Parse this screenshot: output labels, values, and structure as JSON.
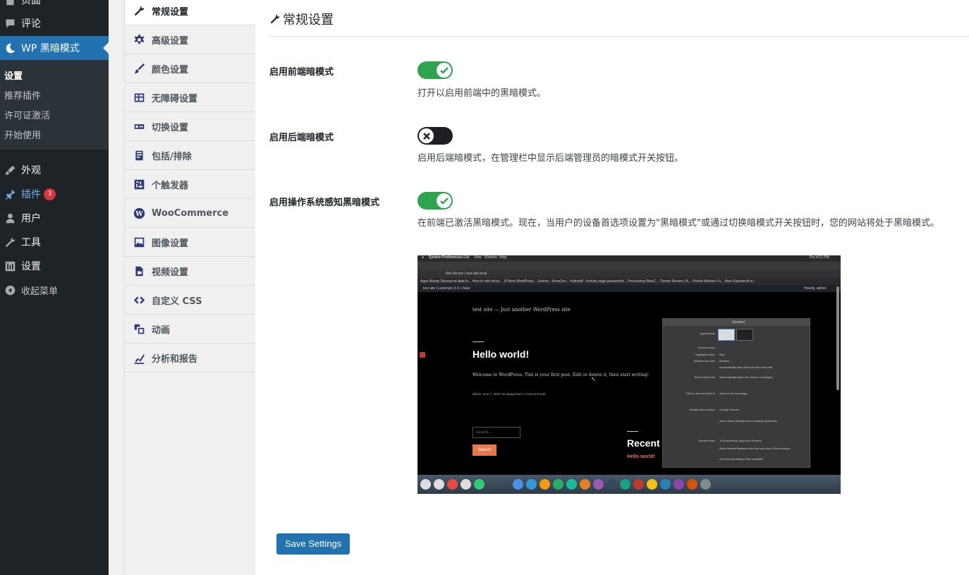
{
  "admin_menu": {
    "items": [
      {
        "label": "页面",
        "icon": "pages-icon"
      },
      {
        "label": "评论",
        "icon": "comments-icon"
      },
      {
        "label": "WP 黑暗模式",
        "icon": "moon-icon",
        "current": true
      },
      {
        "label": "外观",
        "icon": "appearance-brush-icon"
      },
      {
        "label": "插件",
        "icon": "plugins-icon",
        "badge": "3"
      },
      {
        "label": "用户",
        "icon": "users-icon"
      },
      {
        "label": "工具",
        "icon": "tools-wrench-icon"
      },
      {
        "label": "设置",
        "icon": "settings-sliders-icon"
      },
      {
        "label": "收起菜单",
        "icon": "collapse-arrow-icon"
      }
    ],
    "submenu": [
      {
        "label": "设置",
        "active": true
      },
      {
        "label": "推荐插件"
      },
      {
        "label": "许可证激活"
      },
      {
        "label": "开始使用"
      }
    ]
  },
  "settings_nav": {
    "items": [
      {
        "label": "常规设置",
        "icon": "wrench-icon",
        "active": true
      },
      {
        "label": "高级设置",
        "icon": "gear-icon"
      },
      {
        "label": "颜色设置",
        "icon": "paintbrush-icon"
      },
      {
        "label": "无障碍设置",
        "icon": "table-icon"
      },
      {
        "label": "切换设置",
        "icon": "toggle-switch-icon"
      },
      {
        "label": "包括/排除",
        "icon": "clipboard-icon"
      },
      {
        "label": "个触发器",
        "icon": "trigger-icon"
      },
      {
        "label": "WooCommerce",
        "icon": "wordpress-icon"
      },
      {
        "label": "图像设置",
        "icon": "image-icon"
      },
      {
        "label": "视频设置",
        "icon": "video-file-icon"
      },
      {
        "label": "自定义 CSS",
        "icon": "code-icon"
      },
      {
        "label": "动画",
        "icon": "animation-icon"
      },
      {
        "label": "分析和报告",
        "icon": "chart-icon"
      }
    ]
  },
  "main": {
    "title": "常规设置",
    "rows": [
      {
        "label": "启用前端暗模式",
        "enabled": true,
        "description": "打开以启用前端中的黑暗模式。"
      },
      {
        "label": "启用后端暗模式",
        "enabled": false,
        "description": "启用后端暗模式，在管理栏中显示后端管理员的暗模式开关按钮。"
      },
      {
        "label": "启用操作系统感知黑暗模式",
        "enabled": true,
        "description": "在前端已激活黑暗模式。现在，当用户的设备首选项设置为\"黑暗模式\"或通过切换暗模式开关按钮时，您的网站将处于黑暗模式。"
      }
    ],
    "save_label": "Save Settings"
  },
  "preview": {
    "menubar_app": "System Preferences",
    "menubar_items": [
      "Edit",
      "View",
      "Window",
      "Help"
    ],
    "menubar_clock": "Thu 4:21 PM",
    "address": "Not Secure | test-site.local",
    "bookmarks": "Apps   Wamp   Structured data fo...   How to edit struct...   15 Best WordPress...   Entries ‹ KeenDev...   Hubstaff - Activity   page passwords...   Processing WooC...   Theme Review | A...   Pocket Addons Fo...   New Superdraft w...",
    "admin_bar": "test site   Customize   3   0   + New",
    "admin_bar_right": "Howdy, admin",
    "site_title": "test site — Just another WordPress site",
    "post_title": "Hello world!",
    "post_excerpt": "Welcome to WordPress. This is your first post. Edit or delete it, then start writing!",
    "post_meta": "admin   June 1, 2020   Uncategorized   1 Comment   Edit",
    "search_placeholder": "Search ...",
    "search_button": "Search",
    "recent_title": "Recent",
    "recent_link": "Hello world!",
    "prefs_title": "General",
    "prefs_rows": [
      {
        "label": "Appearance",
        "value": "Light      Dark"
      },
      {
        "label": "Accent colour",
        "value": ""
      },
      {
        "label": "Highlight colour",
        "value": "Blue"
      },
      {
        "label": "Sidebar icon size",
        "value": "Medium"
      },
      {
        "label": "",
        "value": "Automatically hide and show the menu bar"
      },
      {
        "label": "Show scroll bars",
        "value": "Automatically based on mouse or trackpad"
      },
      {
        "label": "Click in the scroll bar to",
        "value": "Jump to the next page"
      },
      {
        "label": "Default web browser",
        "value": "Google Chrome"
      },
      {
        "label": "",
        "value": "Ask to keep changes when closing documents"
      },
      {
        "label": "Recent items",
        "value": "10   Documents, Apps and Servers"
      },
      {
        "label": "",
        "value": "Allow Handoff between this Mac and your iCloud devices"
      },
      {
        "label": "",
        "value": "Use font smoothing when available"
      }
    ],
    "dock_colors": [
      "#ddd",
      "#ddd",
      "#e74c3c",
      "#ddd",
      "#2ecc71",
      "#4a90e2",
      "#3498db",
      "#f39c12",
      "#27ae60",
      "#1abc9c",
      "#e67e22",
      "#9b59b6",
      "#34495e",
      "#16a085",
      "#c0392b",
      "#f1c40f",
      "#2980b9",
      "#8e44ad",
      "#d35400",
      "#7f8c8d"
    ]
  }
}
